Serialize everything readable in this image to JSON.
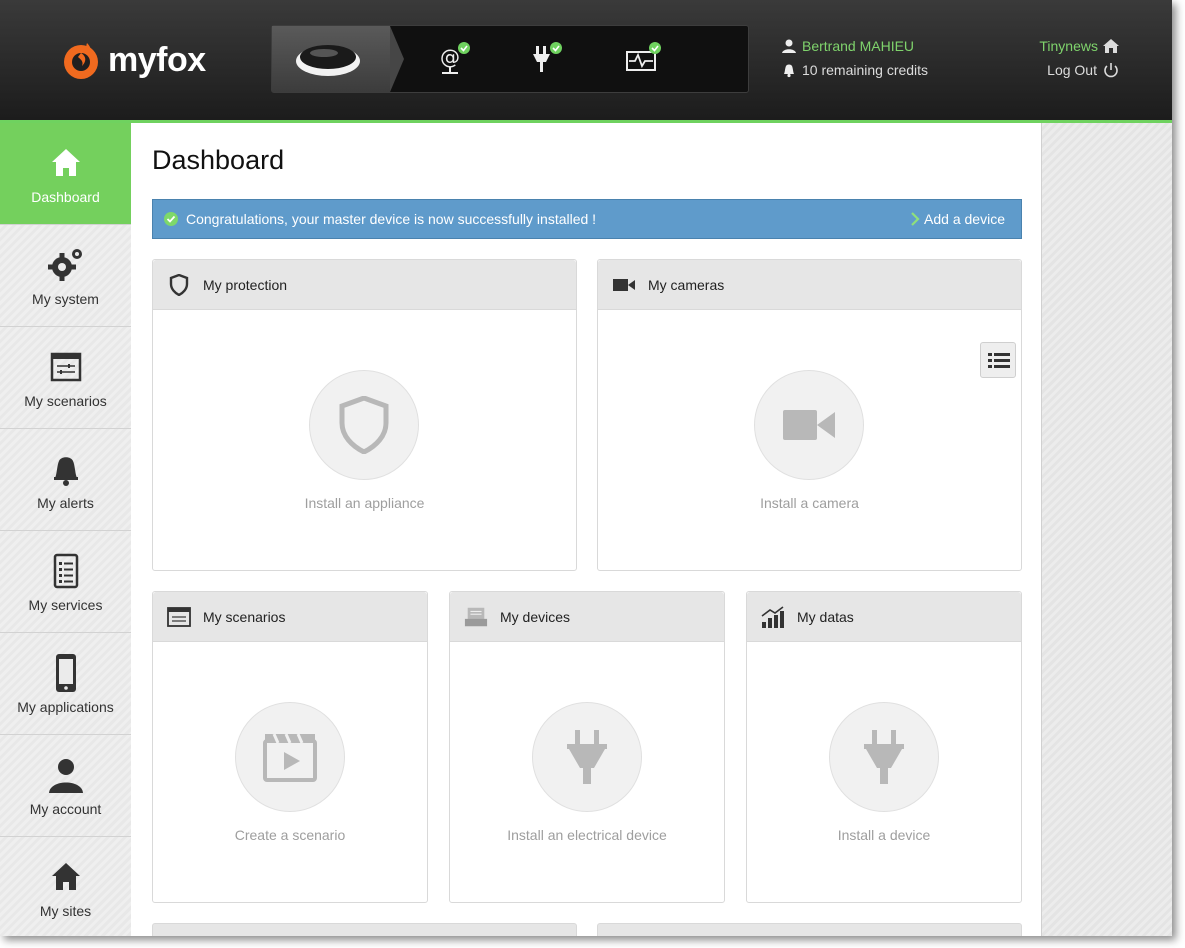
{
  "header": {
    "logo_text": "myfox",
    "user_name": "Bertrand MAHIEU",
    "credits": "10 remaining credits",
    "site_name": "Tinynews",
    "logout_label": "Log Out",
    "status_icons": [
      "master-device-icon",
      "internet-connection-icon",
      "power-supply-icon",
      "signal-monitor-icon"
    ],
    "status_color": "#6fd25f"
  },
  "sidebar": {
    "items": [
      {
        "label": "Dashboard",
        "icon": "home-icon",
        "active": true
      },
      {
        "label": "My system",
        "icon": "gears-icon"
      },
      {
        "label": "My scenarios",
        "icon": "scenarios-icon"
      },
      {
        "label": "My alerts",
        "icon": "bell-icon"
      },
      {
        "label": "My services",
        "icon": "clipboard-icon"
      },
      {
        "label": "My applications",
        "icon": "smartphone-icon"
      },
      {
        "label": "My account",
        "icon": "user-icon"
      },
      {
        "label": "My sites",
        "icon": "home-icon"
      }
    ],
    "active_color": "#74d05d"
  },
  "main": {
    "title": "Dashboard",
    "alert": {
      "message": "Congratulations, your master device is now successfully installed !",
      "action": "Add a device",
      "color": "#5f9bcb"
    },
    "cards": {
      "protection": {
        "title": "My protection",
        "caption": "Install an appliance"
      },
      "cameras": {
        "title": "My cameras",
        "caption": "Install a camera"
      },
      "scenarios": {
        "title": "My scenarios",
        "caption": "Create a scenario"
      },
      "devices": {
        "title": "My devices",
        "caption": "Install an electrical device"
      },
      "datas": {
        "title": "My datas",
        "caption": "Install a device"
      }
    }
  }
}
